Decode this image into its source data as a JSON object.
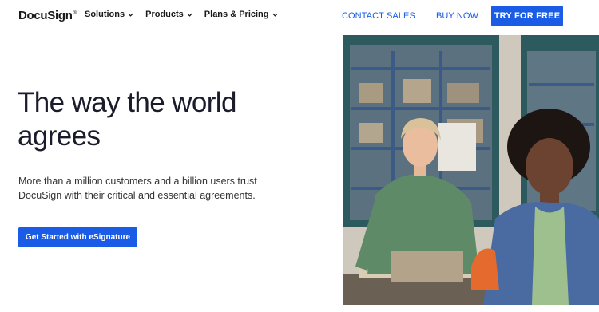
{
  "header": {
    "logo_text": "DocuSign",
    "nav": [
      {
        "label": "Solutions"
      },
      {
        "label": "Products"
      },
      {
        "label": "Plans & Pricing"
      }
    ],
    "contact_sales": "CONTACT SALES",
    "buy_now": "BUY NOW",
    "try_free": "TRY FOR FREE"
  },
  "hero": {
    "headline_line1": "The way the world",
    "headline_line2": "agrees",
    "subtext": "More than a million customers and a billion users trust DocuSign with their critical and essential agreements.",
    "cta_label": "Get Started with eSignature"
  },
  "colors": {
    "brand_blue": "#1a5ce6",
    "headline": "#1b1b2b"
  },
  "icons": {
    "nav_chevron": "chevron-down-icon"
  }
}
